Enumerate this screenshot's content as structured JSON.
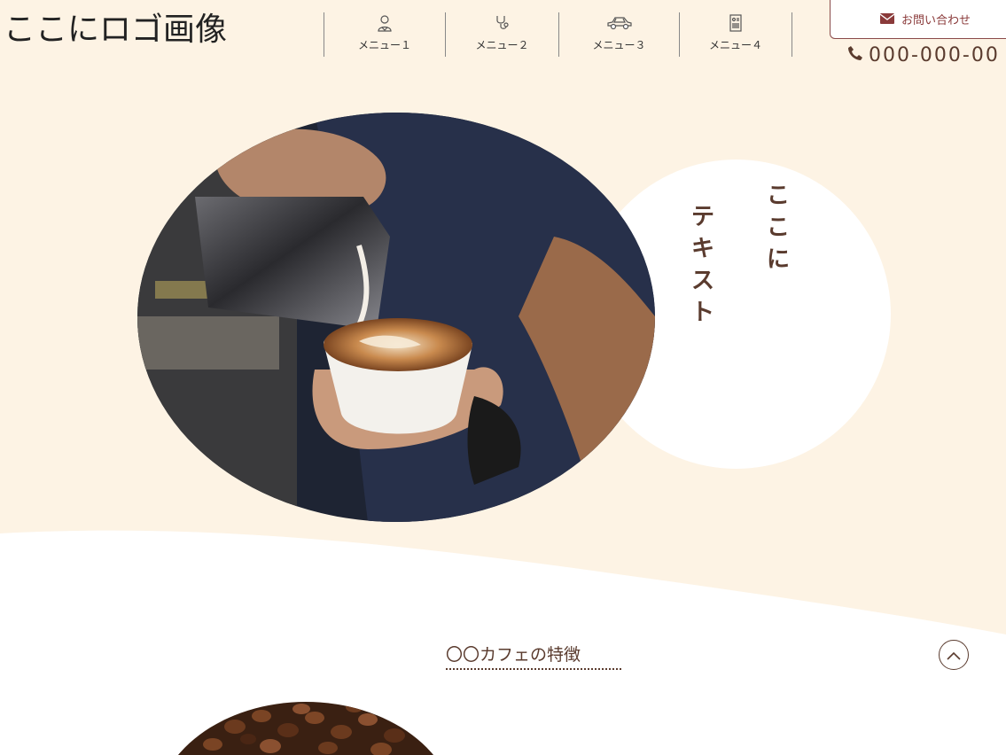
{
  "header": {
    "logo_text": "ここにロゴ画像",
    "nav": [
      {
        "label": "メニュー１",
        "icon": "user-icon"
      },
      {
        "label": "メニュー２",
        "icon": "stethoscope-icon"
      },
      {
        "label": "メニュー３",
        "icon": "car-icon"
      },
      {
        "label": "メニュー４",
        "icon": "document-icon"
      }
    ],
    "contact_label": "お問い合わせ",
    "contact_icon": "mail-icon",
    "phone": "000-000-00",
    "phone_icon": "phone-icon"
  },
  "hero": {
    "col1": [
      "こ",
      "こ",
      "に"
    ],
    "col2": [
      "テ",
      "キ",
      "ス",
      "ト"
    ]
  },
  "section": {
    "title": "〇〇カフェの特徴"
  },
  "colors": {
    "cream": "#fdf3e4",
    "brown": "#5a3b2e",
    "contact_red": "#8a3a3a"
  }
}
